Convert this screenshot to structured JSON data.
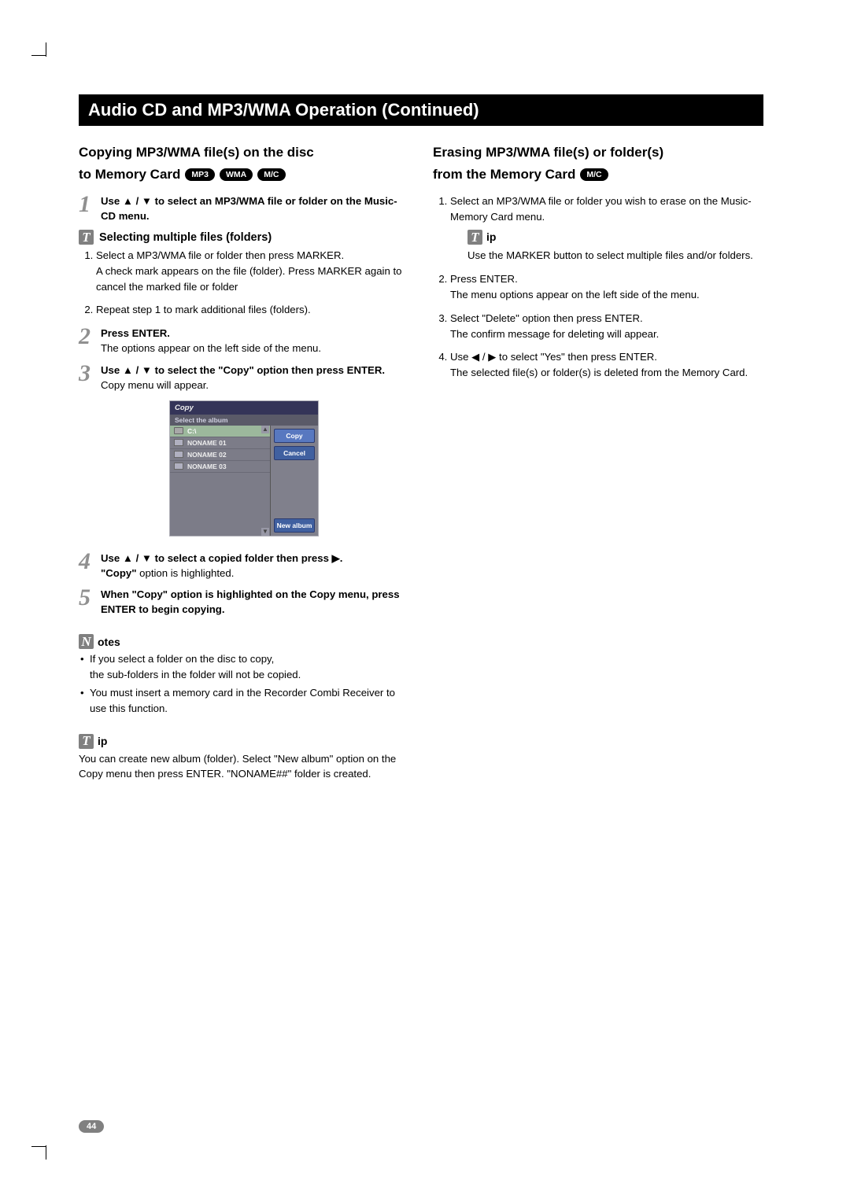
{
  "title_bar": "Audio CD and MP3/WMA Operation (Continued)",
  "badges": {
    "mp3": "MP3",
    "wma": "WMA",
    "mc": "M/C"
  },
  "left": {
    "heading_l1": "Copying MP3/WMA file(s) on the disc",
    "heading_l2": "to Memory Card",
    "step1": "Use ▲ / ▼ to select an MP3/WMA file or folder on the Music-CD menu.",
    "sub_head": "Selecting multiple files (folders)",
    "list1_item1a": "Select a MP3/WMA file or folder then press MARKER.",
    "list1_item1b": "A check mark appears on the file (folder). Press MARKER again to cancel the marked file or folder",
    "list1_item2": "Repeat step 1 to mark additional files (folders).",
    "step2_bold": "Press ENTER.",
    "step2_body": "The options appear on the left side of the menu.",
    "step3_bold": "Use ▲ / ▼ to select the \"Copy\" option then press ENTER.",
    "step3_body": "Copy menu will appear.",
    "step4_bold_a": "Use ▲ / ▼ to select a copied folder then press ▶.",
    "step4_b_bold": "\"Copy\"",
    "step4_b_rest": " option is highlighted.",
    "step5": "When \"Copy\" option is highlighted on the Copy menu, press ENTER to begin copying.",
    "notes_head": "otes",
    "notes_1a": "If you select a folder on the disc to copy,",
    "notes_1b": "the sub-folders in the folder will not be copied.",
    "notes_2": "You must insert a memory card in the Recorder Combi Receiver to use this function.",
    "tip_head": "ip",
    "tip_body": "You can create new album (folder). Select \"New album\" option on the Copy menu then press ENTER. \"NONAME##\" folder is created."
  },
  "right": {
    "heading_l1": "Erasing MP3/WMA file(s) or folder(s)",
    "heading_l2": "from the Memory Card",
    "item1": "Select an MP3/WMA file or folder you wish to erase on the Music-Memory Card menu.",
    "tip_head": "ip",
    "tip_body": "Use the MARKER button to select multiple files and/or folders.",
    "item2a": "Press ENTER.",
    "item2b": "The menu options appear on the left side of the menu.",
    "item3a": "Select \"Delete\" option then press ENTER.",
    "item3b": "The confirm message for deleting will appear.",
    "item4a": "Use ◀ / ▶ to select \"Yes\" then press ENTER.",
    "item4b": "The selected file(s) or folder(s) is deleted from the Memory Card."
  },
  "copy_ui": {
    "title": "Copy",
    "sub": "Select the album",
    "rows": [
      "C:\\",
      "NONAME 01",
      "NONAME 02",
      "NONAME 03"
    ],
    "buttons": {
      "copy": "Copy",
      "cancel": "Cancel",
      "new_album": "New album"
    }
  },
  "page_number": "44"
}
